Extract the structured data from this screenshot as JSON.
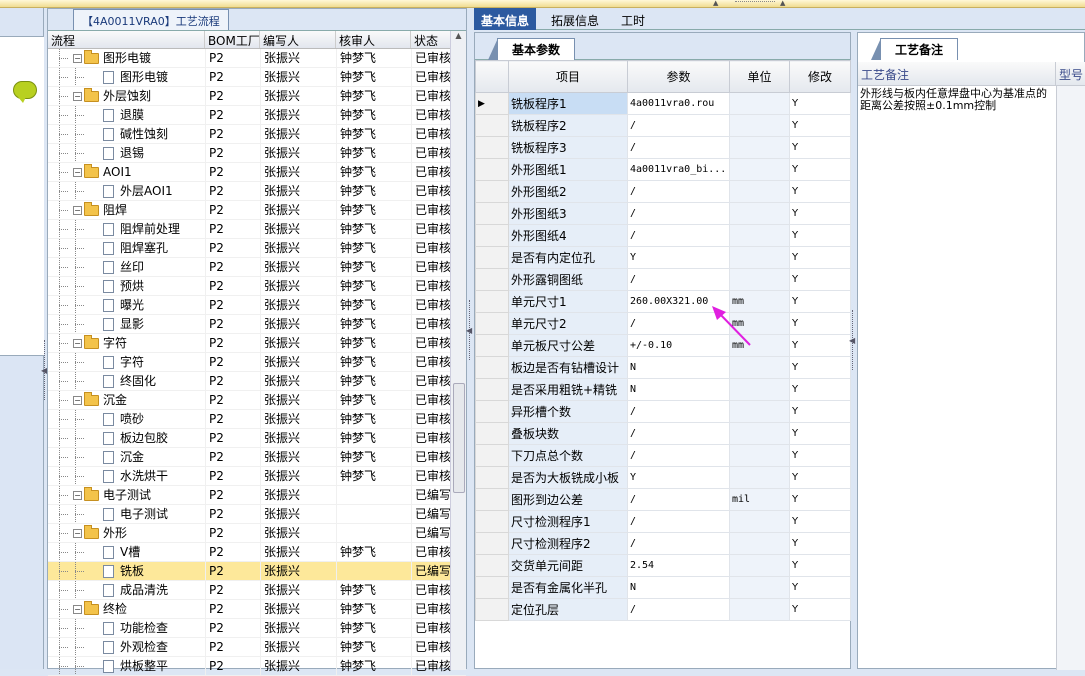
{
  "tree": {
    "tab_title": "【4A0011VRA0】工艺流程",
    "columns": [
      "流程",
      "BOM工厂",
      "编写人",
      "核审人",
      "状态"
    ],
    "rows": [
      {
        "level": 1,
        "folder": true,
        "name": "图形电镀",
        "bom": "P2",
        "writer": "张振兴",
        "reviewer": "钟梦飞",
        "status": "已审核"
      },
      {
        "level": 2,
        "folder": false,
        "name": "图形电镀",
        "bom": "P2",
        "writer": "张振兴",
        "reviewer": "钟梦飞",
        "status": "已审核"
      },
      {
        "level": 1,
        "folder": true,
        "name": "外层蚀刻",
        "bom": "P2",
        "writer": "张振兴",
        "reviewer": "钟梦飞",
        "status": "已审核"
      },
      {
        "level": 2,
        "folder": false,
        "name": "退膜",
        "bom": "P2",
        "writer": "张振兴",
        "reviewer": "钟梦飞",
        "status": "已审核"
      },
      {
        "level": 2,
        "folder": false,
        "name": "碱性蚀刻",
        "bom": "P2",
        "writer": "张振兴",
        "reviewer": "钟梦飞",
        "status": "已审核"
      },
      {
        "level": 2,
        "folder": false,
        "name": "退锡",
        "bom": "P2",
        "writer": "张振兴",
        "reviewer": "钟梦飞",
        "status": "已审核"
      },
      {
        "level": 1,
        "folder": true,
        "name": "AOI1",
        "bom": "P2",
        "writer": "张振兴",
        "reviewer": "钟梦飞",
        "status": "已审核"
      },
      {
        "level": 2,
        "folder": false,
        "name": "外层AOI1",
        "bom": "P2",
        "writer": "张振兴",
        "reviewer": "钟梦飞",
        "status": "已审核"
      },
      {
        "level": 1,
        "folder": true,
        "name": "阻焊",
        "bom": "P2",
        "writer": "张振兴",
        "reviewer": "钟梦飞",
        "status": "已审核"
      },
      {
        "level": 2,
        "folder": false,
        "name": "阻焊前处理",
        "bom": "P2",
        "writer": "张振兴",
        "reviewer": "钟梦飞",
        "status": "已审核"
      },
      {
        "level": 2,
        "folder": false,
        "name": "阻焊塞孔",
        "bom": "P2",
        "writer": "张振兴",
        "reviewer": "钟梦飞",
        "status": "已审核"
      },
      {
        "level": 2,
        "folder": false,
        "name": "丝印",
        "bom": "P2",
        "writer": "张振兴",
        "reviewer": "钟梦飞",
        "status": "已审核"
      },
      {
        "level": 2,
        "folder": false,
        "name": "预烘",
        "bom": "P2",
        "writer": "张振兴",
        "reviewer": "钟梦飞",
        "status": "已审核"
      },
      {
        "level": 2,
        "folder": false,
        "name": "曝光",
        "bom": "P2",
        "writer": "张振兴",
        "reviewer": "钟梦飞",
        "status": "已审核"
      },
      {
        "level": 2,
        "folder": false,
        "name": "显影",
        "bom": "P2",
        "writer": "张振兴",
        "reviewer": "钟梦飞",
        "status": "已审核"
      },
      {
        "level": 1,
        "folder": true,
        "name": "字符",
        "bom": "P2",
        "writer": "张振兴",
        "reviewer": "钟梦飞",
        "status": "已审核"
      },
      {
        "level": 2,
        "folder": false,
        "name": "字符",
        "bom": "P2",
        "writer": "张振兴",
        "reviewer": "钟梦飞",
        "status": "已审核"
      },
      {
        "level": 2,
        "folder": false,
        "name": "终固化",
        "bom": "P2",
        "writer": "张振兴",
        "reviewer": "钟梦飞",
        "status": "已审核"
      },
      {
        "level": 1,
        "folder": true,
        "name": "沉金",
        "bom": "P2",
        "writer": "张振兴",
        "reviewer": "钟梦飞",
        "status": "已审核"
      },
      {
        "level": 2,
        "folder": false,
        "name": "喷砂",
        "bom": "P2",
        "writer": "张振兴",
        "reviewer": "钟梦飞",
        "status": "已审核"
      },
      {
        "level": 2,
        "folder": false,
        "name": "板边包胶",
        "bom": "P2",
        "writer": "张振兴",
        "reviewer": "钟梦飞",
        "status": "已审核"
      },
      {
        "level": 2,
        "folder": false,
        "name": "沉金",
        "bom": "P2",
        "writer": "张振兴",
        "reviewer": "钟梦飞",
        "status": "已审核"
      },
      {
        "level": 2,
        "folder": false,
        "name": "水洗烘干",
        "bom": "P2",
        "writer": "张振兴",
        "reviewer": "钟梦飞",
        "status": "已审核"
      },
      {
        "level": 1,
        "folder": true,
        "name": "电子测试",
        "bom": "P2",
        "writer": "张振兴",
        "reviewer": "",
        "status": "已编写"
      },
      {
        "level": 2,
        "folder": false,
        "name": "电子测试",
        "bom": "P2",
        "writer": "张振兴",
        "reviewer": "",
        "status": "已编写"
      },
      {
        "level": 1,
        "folder": true,
        "name": "外形",
        "bom": "P2",
        "writer": "张振兴",
        "reviewer": "",
        "status": "已编写"
      },
      {
        "level": 2,
        "folder": false,
        "name": "V槽",
        "bom": "P2",
        "writer": "张振兴",
        "reviewer": "钟梦飞",
        "status": "已审核"
      },
      {
        "level": 2,
        "folder": false,
        "name": "铣板",
        "bom": "P2",
        "writer": "张振兴",
        "reviewer": "",
        "status": "已编写",
        "selected": true
      },
      {
        "level": 2,
        "folder": false,
        "name": "成品清洗",
        "bom": "P2",
        "writer": "张振兴",
        "reviewer": "钟梦飞",
        "status": "已审核"
      },
      {
        "level": 1,
        "folder": true,
        "name": "终检",
        "bom": "P2",
        "writer": "张振兴",
        "reviewer": "钟梦飞",
        "status": "已审核"
      },
      {
        "level": 2,
        "folder": false,
        "name": "功能检查",
        "bom": "P2",
        "writer": "张振兴",
        "reviewer": "钟梦飞",
        "status": "已审核"
      },
      {
        "level": 2,
        "folder": false,
        "name": "外观检查",
        "bom": "P2",
        "writer": "张振兴",
        "reviewer": "钟梦飞",
        "status": "已审核"
      },
      {
        "level": 2,
        "folder": false,
        "name": "烘板整平",
        "bom": "P2",
        "writer": "张振兴",
        "reviewer": "钟梦飞",
        "status": "已审核"
      }
    ]
  },
  "main_tabs": [
    "基本信息",
    "拓展信息",
    "工时"
  ],
  "params": {
    "tab_title": "基本参数",
    "columns": [
      "项目",
      "参数",
      "单位",
      "修改"
    ],
    "row_marker": "▶",
    "rows": [
      {
        "item": "铣板程序1",
        "value": "4a0011vra0.rou",
        "unit": "",
        "mod": "Y"
      },
      {
        "item": "铣板程序2",
        "value": "/",
        "unit": "",
        "mod": "Y"
      },
      {
        "item": "铣板程序3",
        "value": "/",
        "unit": "",
        "mod": "Y"
      },
      {
        "item": "外形图纸1",
        "value": "4a0011vra0_bi...",
        "unit": "",
        "mod": "Y"
      },
      {
        "item": "外形图纸2",
        "value": "/",
        "unit": "",
        "mod": "Y"
      },
      {
        "item": "外形图纸3",
        "value": "/",
        "unit": "",
        "mod": "Y"
      },
      {
        "item": "外形图纸4",
        "value": "/",
        "unit": "",
        "mod": "Y"
      },
      {
        "item": "是否有内定位孔",
        "value": "Y",
        "unit": "",
        "mod": "Y"
      },
      {
        "item": "外形露铜图纸",
        "value": "/",
        "unit": "",
        "mod": "Y"
      },
      {
        "item": "单元尺寸1",
        "value": "260.00X321.00",
        "unit": "mm",
        "mod": "Y"
      },
      {
        "item": "单元尺寸2",
        "value": "/",
        "unit": "mm",
        "mod": "Y"
      },
      {
        "item": "单元板尺寸公差",
        "value": "+/-0.10",
        "unit": "mm",
        "mod": "Y"
      },
      {
        "item": "板边是否有钻槽设计",
        "value": "N",
        "unit": "",
        "mod": "Y"
      },
      {
        "item": "是否采用粗铣+精铣",
        "value": "N",
        "unit": "",
        "mod": "Y"
      },
      {
        "item": "异形槽个数",
        "value": "/",
        "unit": "",
        "mod": "Y"
      },
      {
        "item": "叠板块数",
        "value": "/",
        "unit": "",
        "mod": "Y"
      },
      {
        "item": "下刀点总个数",
        "value": "/",
        "unit": "",
        "mod": "Y"
      },
      {
        "item": "是否为大板铣成小板",
        "value": "Y",
        "unit": "",
        "mod": "Y"
      },
      {
        "item": "图形到边公差",
        "value": "/",
        "unit": "mil",
        "mod": "Y"
      },
      {
        "item": "尺寸检测程序1",
        "value": "/",
        "unit": "",
        "mod": "Y"
      },
      {
        "item": "尺寸检测程序2",
        "value": "/",
        "unit": "",
        "mod": "Y"
      },
      {
        "item": "交货单元间距",
        "value": "2.54",
        "unit": "",
        "mod": "Y"
      },
      {
        "item": "是否有金属化半孔",
        "value": "N",
        "unit": "",
        "mod": "Y"
      },
      {
        "item": "定位孔层",
        "value": "/",
        "unit": "",
        "mod": "Y"
      }
    ]
  },
  "notes": {
    "tab_title": "工艺备注",
    "columns": [
      "工艺备注",
      "型号"
    ],
    "text": "外形线与板内任意焊盘中心为基准点的距离公差按照±0.1mm控制"
  },
  "colors": {
    "annotation_arrow": "#e020e0",
    "active_tab": "#2c5aa0",
    "selected_row": "#fde89a"
  }
}
